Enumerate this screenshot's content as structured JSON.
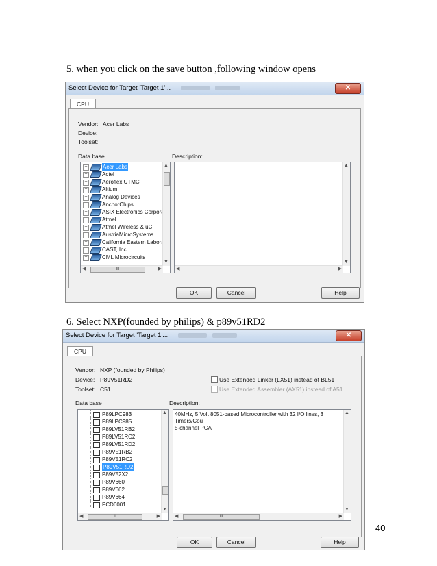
{
  "step5": {
    "text": "5.   when you click on  the save button ,following window opens"
  },
  "step6": {
    "text": "6.   Select NXP(founded by philips) & p89v51RD2"
  },
  "page_number": "40",
  "dialog1": {
    "title": "Select Device for Target 'Target 1'...",
    "close": "✕",
    "tab": "CPU",
    "vendor_label": "Vendor:",
    "vendor_value": "Acer Labs",
    "device_label": "Device:",
    "toolset_label": "Toolset:",
    "database_label": "Data base",
    "description_label": "Description:",
    "tree_items": [
      "Acer Labs",
      "Actel",
      "Aeroflex UTMC",
      "Altium",
      "Analog Devices",
      "AnchorChips",
      "ASIX Electronics Corporat",
      "Atmel",
      "Atmel Wireless & uC",
      "AustriaMicroSystems",
      "California Eastern Laborat",
      "CAST, Inc.",
      "CML Microcircuits"
    ],
    "hscroll_thumb": "III",
    "ok": "OK",
    "cancel": "Cancel",
    "help": "Help"
  },
  "dialog2": {
    "title": "Select Device for Target 'Target 1'...",
    "close": "✕",
    "tab": "CPU",
    "vendor_label": "Vendor:",
    "vendor_value": "NXP (founded by Philips)",
    "device_label": "Device:",
    "device_value": "P89V51RD2",
    "toolset_label": "Toolset:",
    "toolset_value": "C51",
    "ext_linker": "Use Extended Linker (LX51) instead of BL51",
    "ext_assembler": "Use Extended Assembler (AX51) instead of A51",
    "database_label": "Data base",
    "description_label": "Description:",
    "device_items": [
      "P89LPC983",
      "P89LPC985",
      "P89LV51RB2",
      "P89LV51RC2",
      "P89LV51RD2",
      "P89V51RB2",
      "P89V51RC2",
      "P89V51RD2",
      "P89V52X2",
      "P89V660",
      "P89V662",
      "P89V664",
      "PCD6001"
    ],
    "selected_index": 7,
    "description_text": [
      "40MHz, 5 Volt 8051-based Microcontroller with 32 I/O lines, 3 Timers/Cou",
      "5-channel PCA"
    ],
    "hscroll_thumb": "III",
    "ok": "OK",
    "cancel": "Cancel",
    "help": "Help"
  },
  "colors": {
    "selection": "#3399ff",
    "dialog_bg": "#f0f0f0",
    "close_button": "#c7402a"
  }
}
